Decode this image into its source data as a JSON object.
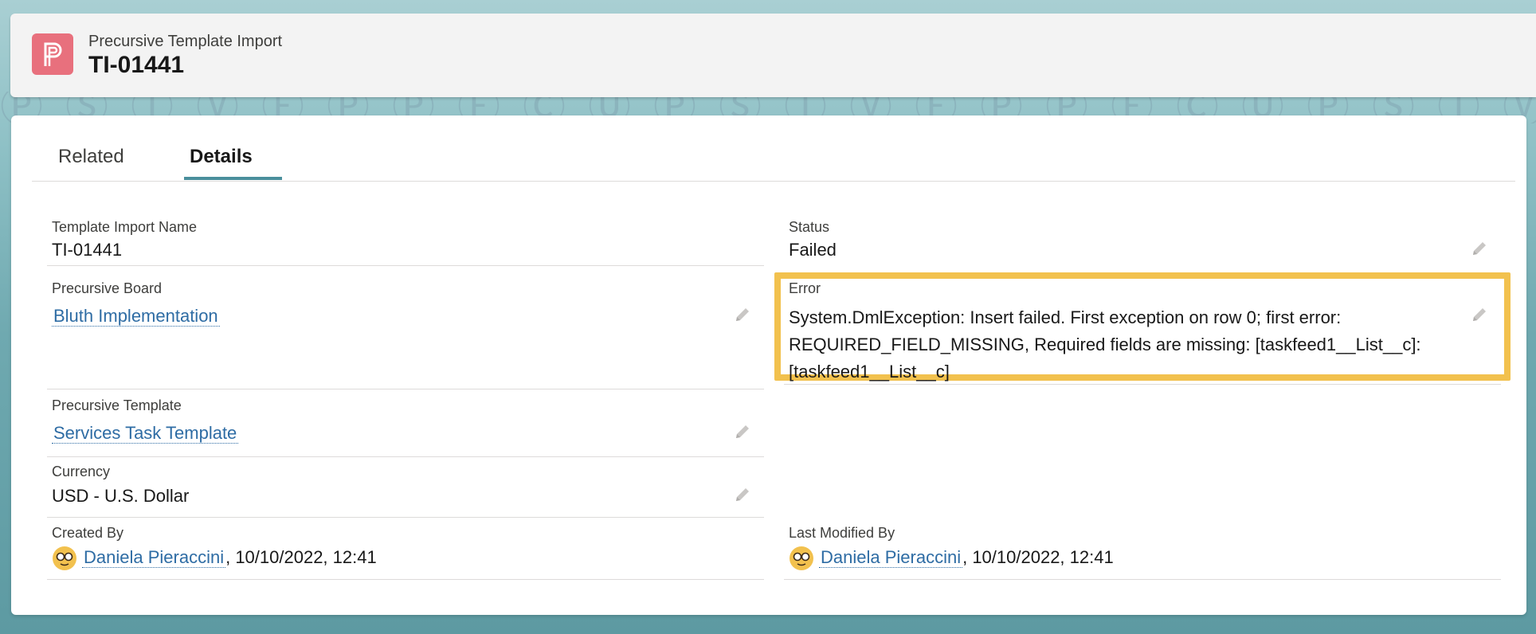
{
  "header": {
    "object_label": "Precursive Template Import",
    "record_title": "TI-01441",
    "icon": "precursive-logo-icon",
    "icon_color": "#e8707d"
  },
  "tabs": [
    {
      "label": "Related",
      "active": false
    },
    {
      "label": "Details",
      "active": true
    }
  ],
  "accent_color": "#4a8f9c",
  "highlight_color": "#f2c14e",
  "link_color": "#2e6ca4",
  "fields": {
    "template_import_name": {
      "label": "Template Import Name",
      "value": "TI-01441"
    },
    "status": {
      "label": "Status",
      "value": "Failed"
    },
    "precursive_board": {
      "label": "Precursive Board",
      "value": "Bluth Implementation"
    },
    "error": {
      "label": "Error",
      "value": "System.DmlException: Insert failed. First exception on row 0; first error: REQUIRED_FIELD_MISSING, Required fields are missing: [taskfeed1__List__c]: [taskfeed1__List__c]"
    },
    "precursive_template": {
      "label": "Precursive Template",
      "value": "Services Task Template"
    },
    "currency": {
      "label": "Currency",
      "value": "USD - U.S. Dollar"
    },
    "created_by": {
      "label": "Created By",
      "user": "Daniela Pieraccini",
      "timestamp": ", 10/10/2022, 12:41"
    },
    "last_modified_by": {
      "label": "Last Modified By",
      "user": "Daniela Pieraccini",
      "timestamp": ", 10/10/2022, 12:41"
    }
  }
}
